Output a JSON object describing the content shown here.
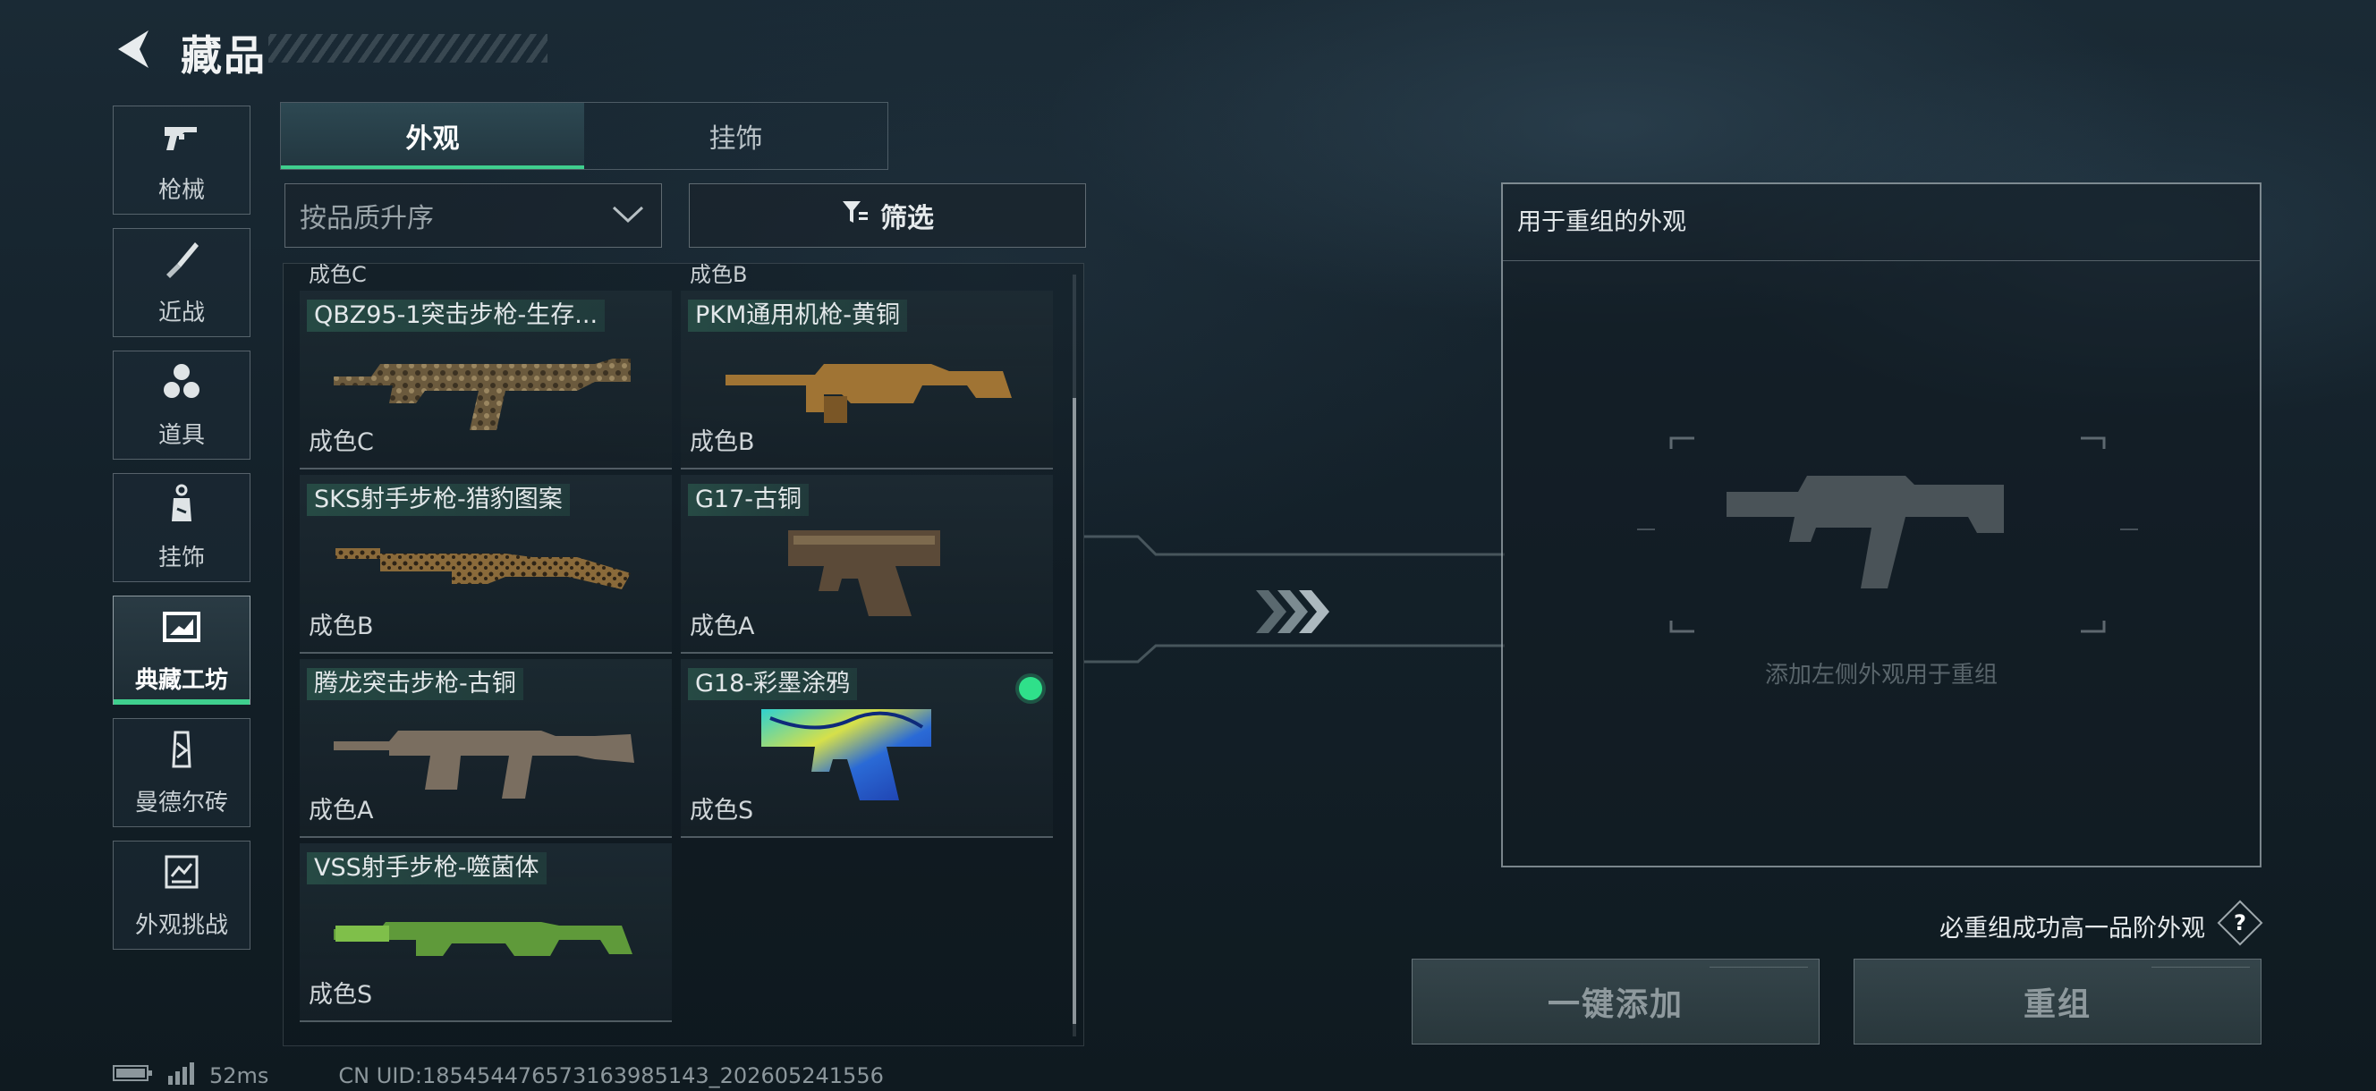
{
  "header": {
    "title": "藏品"
  },
  "sidebar": {
    "items": [
      {
        "label": "枪械",
        "icon": "pistol-icon"
      },
      {
        "label": "近战",
        "icon": "knife-icon"
      },
      {
        "label": "道具",
        "icon": "grenades-icon"
      },
      {
        "label": "挂饰",
        "icon": "charm-icon"
      },
      {
        "label": "典藏工坊",
        "icon": "workshop-icon",
        "active": true
      },
      {
        "label": "曼德尔砖",
        "icon": "brick-icon"
      },
      {
        "label": "外观挑战",
        "icon": "challenge-icon"
      }
    ]
  },
  "tabs": [
    {
      "label": "外观",
      "active": true
    },
    {
      "label": "挂饰",
      "active": false
    }
  ],
  "sort": {
    "value": "按品质升序"
  },
  "filter": {
    "label": "筛选"
  },
  "grid": {
    "peek_left": "成色C",
    "peek_right": "成色B",
    "items": [
      {
        "name": "QBZ95-1突击步枪-生存...",
        "grade": "成色C",
        "skin": "camo-brown"
      },
      {
        "name": "PKM通用机枪-黄铜",
        "grade": "成色B",
        "skin": "brass"
      },
      {
        "name": "SKS射手步枪-猎豹图案",
        "grade": "成色B",
        "skin": "leopard"
      },
      {
        "name": "G17-古铜",
        "grade": "成色A",
        "skin": "bronze"
      },
      {
        "name": "腾龙突击步枪-古铜",
        "grade": "成色A",
        "skin": "bronze"
      },
      {
        "name": "G18-彩墨涂鸦",
        "grade": "成色S",
        "skin": "graffiti",
        "selected": true
      },
      {
        "name": "VSS射手步枪-噬菌体",
        "grade": "成色S",
        "skin": "green"
      }
    ]
  },
  "panel": {
    "title": "用于重组的外观",
    "hint": "添加左侧外观用于重组"
  },
  "note": {
    "text": "必重组成功高一品阶外观",
    "help": "?"
  },
  "buttons": {
    "add_all": "一键添加",
    "recombine": "重组"
  },
  "footer": {
    "ping": "52ms",
    "uid": "CN UID:185454476573163985143_202605241556"
  },
  "colors": {
    "accent": "#3fcf8e",
    "selected": "#2fe08a"
  }
}
